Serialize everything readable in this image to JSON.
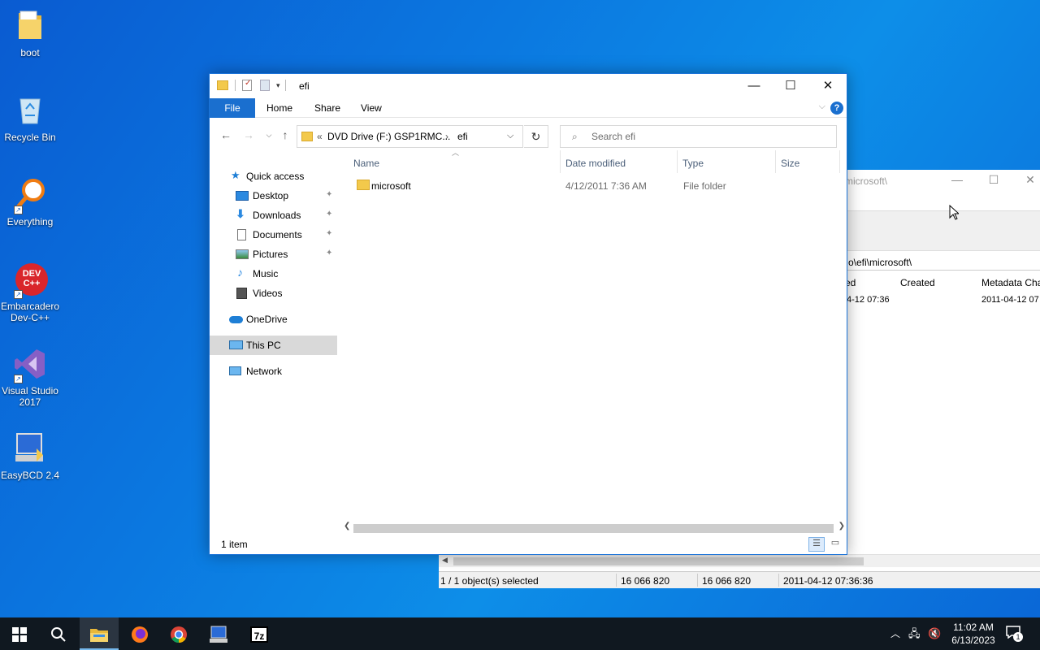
{
  "desktop": {
    "icons": [
      {
        "label": "boot"
      },
      {
        "label": "Recycle Bin"
      },
      {
        "label": "Everything"
      },
      {
        "label": "Embarcadero Dev-C++",
        "badge": "DEV C++"
      },
      {
        "label": "Visual Studio 2017"
      },
      {
        "label": "EasyBCD 2.4"
      }
    ]
  },
  "bg_window": {
    "title": "microsoft\\",
    "path": "o\\efi\\microsoft\\",
    "columns": [
      "ed",
      "Created",
      "Metadata Cha"
    ],
    "row": [
      "4-12 07:36",
      "2011-04-12 07"
    ],
    "status": [
      "1 / 1 object(s) selected",
      "16 066 820",
      "16 066 820",
      "2011-04-12 07:36:36"
    ]
  },
  "explorer": {
    "title": "efi",
    "ribbon": {
      "file": "File",
      "home": "Home",
      "share": "Share",
      "view": "View",
      "help": "?"
    },
    "address": {
      "prefix": "«",
      "drive": "DVD Drive (F:) GSP1RMC...",
      "sep": "›",
      "folder": "efi"
    },
    "search": {
      "placeholder": "Search efi"
    },
    "nav": {
      "quick_access": "Quick access",
      "desktop": "Desktop",
      "downloads": "Downloads",
      "documents": "Documents",
      "pictures": "Pictures",
      "music": "Music",
      "videos": "Videos",
      "onedrive": "OneDrive",
      "this_pc": "This PC",
      "network": "Network"
    },
    "columns": {
      "name": "Name",
      "date": "Date modified",
      "type": "Type",
      "size": "Size"
    },
    "files": [
      {
        "name": "microsoft",
        "date": "4/12/2011 7:36 AM",
        "type": "File folder",
        "size": ""
      }
    ],
    "status": {
      "count": "1 item"
    }
  },
  "taskbar": {
    "clock_time": "11:02 AM",
    "clock_date": "6/13/2023",
    "notification_count": "1",
    "sevenzip_label": "7z"
  },
  "colors": {
    "accent": "#1a6fcf",
    "taskbar": "#101820",
    "folder": "#f3c94b"
  }
}
